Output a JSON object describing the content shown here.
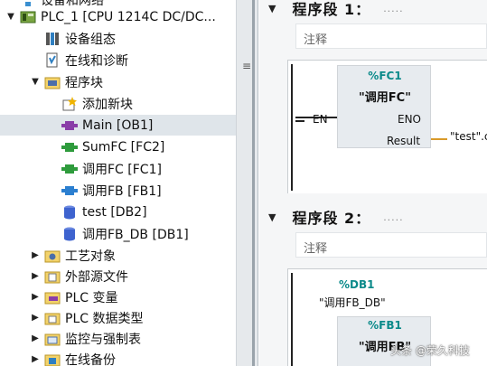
{
  "tree": {
    "items": [
      {
        "label": "设备和网络",
        "icon": "network-icon",
        "level": 0,
        "arrow": ""
      },
      {
        "label": "PLC_1 [CPU 1214C DC/DC...",
        "icon": "plc-icon",
        "level": 0,
        "arrow": "▼"
      },
      {
        "label": "设备组态",
        "icon": "device-config-icon",
        "level": 1,
        "arrow": ""
      },
      {
        "label": "在线和诊断",
        "icon": "online-diagnostics-icon",
        "level": 1,
        "arrow": ""
      },
      {
        "label": "程序块",
        "icon": "program-blocks-folder-icon",
        "level": 1,
        "arrow": "▼"
      },
      {
        "label": "添加新块",
        "icon": "add-new-block-icon",
        "level": 2,
        "arrow": ""
      },
      {
        "label": "Main [OB1]",
        "icon": "ob-block-icon",
        "level": 2,
        "arrow": "",
        "selected": true
      },
      {
        "label": "SumFC [FC2]",
        "icon": "fc-block-icon",
        "level": 2,
        "arrow": ""
      },
      {
        "label": "调用FC [FC1]",
        "icon": "fc-block-icon",
        "level": 2,
        "arrow": ""
      },
      {
        "label": "调用FB [FB1]",
        "icon": "fb-block-icon",
        "level": 2,
        "arrow": ""
      },
      {
        "label": "test [DB2]",
        "icon": "db-block-icon",
        "level": 2,
        "arrow": ""
      },
      {
        "label": "调用FB_DB [DB1]",
        "icon": "db-block-icon",
        "level": 2,
        "arrow": ""
      },
      {
        "label": "工艺对象",
        "icon": "technology-objects-icon",
        "level": 1,
        "arrow": "▶"
      },
      {
        "label": "外部源文件",
        "icon": "external-sources-icon",
        "level": 1,
        "arrow": "▶"
      },
      {
        "label": "PLC 变量",
        "icon": "plc-tags-icon",
        "level": 1,
        "arrow": "▶"
      },
      {
        "label": "PLC 数据类型",
        "icon": "plc-data-types-icon",
        "level": 1,
        "arrow": "▶"
      },
      {
        "label": "监控与强制表",
        "icon": "watch-force-tables-icon",
        "level": 1,
        "arrow": "▶"
      },
      {
        "label": "在线备份",
        "icon": "online-backup-icon",
        "level": 1,
        "arrow": "▶"
      }
    ]
  },
  "splitter": {
    "grip": "≡"
  },
  "editor": {
    "segments": [
      {
        "toggle": "▼",
        "title": "程序段 1：",
        "dots": ".....",
        "comment": "注释",
        "block": {
          "type": "%FC1",
          "name": "\"调用FC\"",
          "en": "EN",
          "eno": "ENO",
          "result_pin": "Result",
          "result_value": "\"test\".c"
        }
      },
      {
        "toggle": "▼",
        "title": "程序段 2：",
        "dots": ".....",
        "comment": "注释",
        "block": {
          "instance_address": "%DB1",
          "instance_name": "\"调用FB_DB\"",
          "type": "%FB1",
          "name": "\"调用FB\""
        }
      }
    ]
  },
  "watermark": "头条 @荣久科技",
  "colors": {
    "selection": "#dfe5ea",
    "block_fill": "#e7ebef",
    "block_address": "#0b8a8a",
    "result_wire": "#d99a2a",
    "editor_bg": "#f5f6f7"
  }
}
